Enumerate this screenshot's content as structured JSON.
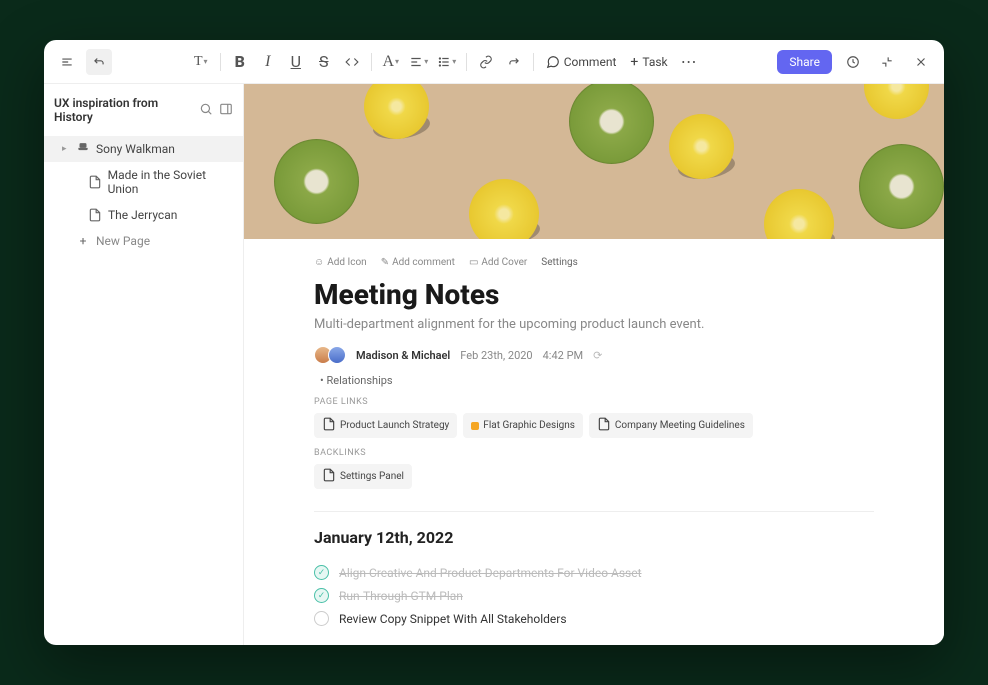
{
  "toolbar": {
    "comment": "Comment",
    "task": "Task",
    "share": "Share"
  },
  "sidebar": {
    "title": "UX inspiration from History",
    "items": [
      {
        "label": "Sony Walkman",
        "active": true
      },
      {
        "label": "Made in the Soviet Union",
        "active": false
      },
      {
        "label": "The Jerrycan",
        "active": false
      }
    ],
    "new_page": "New Page"
  },
  "meta": {
    "add_icon": "Add Icon",
    "add_comment": "Add comment",
    "add_cover": "Add Cover",
    "settings": "Settings"
  },
  "doc": {
    "title": "Meeting Notes",
    "subtitle": "Multi-department alignment for the upcoming product launch event.",
    "authors": "Madison & Michael",
    "date": "Feb 23th, 2020",
    "time": "4:42 PM",
    "relationships": "Relationships"
  },
  "page_links": {
    "label": "PAGE LINKS",
    "items": [
      {
        "label": "Product Launch Strategy",
        "icon": "doc"
      },
      {
        "label": "Flat Graphic Designs",
        "icon": "color",
        "color": "#f5a623"
      },
      {
        "label": "Company Meeting Guidelines",
        "icon": "doc"
      }
    ]
  },
  "backlinks": {
    "label": "BACKLINKS",
    "items": [
      {
        "label": "Settings Panel",
        "icon": "doc"
      }
    ]
  },
  "section": {
    "heading": "January 12th, 2022",
    "tasks": [
      {
        "text": "Align Creative And Product Departments For Video Asset",
        "done": true
      },
      {
        "text": "Run-Through GTM Plan",
        "done": true
      },
      {
        "text": "Review Copy Snippet With All Stakeholders",
        "done": false
      }
    ]
  }
}
